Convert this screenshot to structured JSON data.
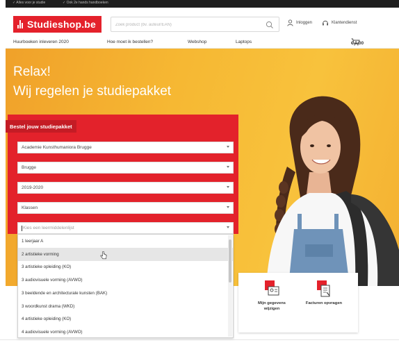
{
  "topbar": {
    "item1": "✓ Alles voor je studie",
    "item2": "✓ Ook 2e hands handboeken"
  },
  "header": {
    "logo_text": "Studieshop.be",
    "search_placeholder": "Zoek product (bv. auteur/EAN)",
    "login_label": "Inloggen",
    "service_label": "Klantendienst"
  },
  "nav": {
    "items": [
      "Huurboeken inleveren 2020",
      "Hoe moet ik bestellen?",
      "Webshop",
      "Laptops"
    ],
    "cart_amount": "€ 0,00"
  },
  "hero": {
    "title": "Relax!",
    "subtitle": "Wij regelen je studiepakket"
  },
  "order_panel": {
    "heading": "Bestel jouw studiepakket",
    "selects": [
      "Academie Kunsthumaniora Brugge",
      "Brugge",
      "2019-2020",
      "Klassen"
    ],
    "year_placeholder": "Kies een leermiddelenlijst",
    "options": [
      "1 leerjaar A",
      "2 artistieke vorming",
      "3 artistieke opleiding (KO)",
      "3 audiovisuele vorming (AVWO)",
      "3 beeldende en architecturale kunsten (BAK)",
      "3 woordkunst drama (WKD)",
      "4 artistieke opleiding (KO)",
      "4 audiovisuele vorming (AVWO)"
    ],
    "highlighted_index": 1
  },
  "info_card": {
    "item1": "Mijn gegevens wijzigen",
    "item2": "Facturen opvragen"
  },
  "colors": {
    "brand_red": "#e4212b",
    "hero_yellow": "#f6b833"
  }
}
